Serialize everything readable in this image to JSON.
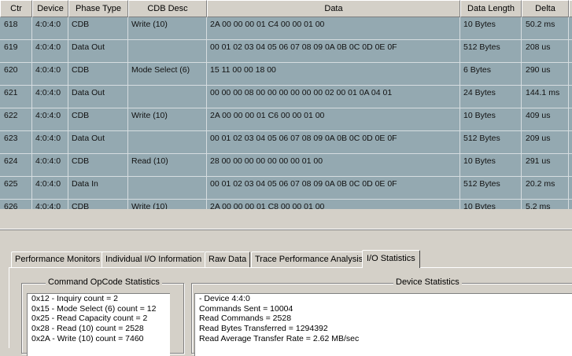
{
  "columns": [
    "Ctr",
    "Device",
    "Phase Type",
    "CDB Desc",
    "Data",
    "Data Length",
    "Delta"
  ],
  "rows": [
    [
      "618",
      "4:0:4:0",
      "CDB",
      "Write (10)",
      "2A 00 00 00 01 C4 00 00 01 00",
      "10 Bytes",
      "50.2 ms"
    ],
    [
      "619",
      "4:0:4:0",
      "Data Out",
      "",
      "00 01 02 03 04 05 06 07 08 09 0A 0B 0C 0D 0E 0F",
      "512 Bytes",
      "208 us"
    ],
    [
      "620",
      "4:0:4:0",
      "CDB",
      "Mode Select (6)",
      "15 11 00 00 18 00",
      "6 Bytes",
      "290 us"
    ],
    [
      "621",
      "4:0:4:0",
      "Data Out",
      "",
      "00 00 00 08 00 00 00 00 00 00 02 00 01 0A 04 01",
      "24 Bytes",
      "144.1 ms"
    ],
    [
      "622",
      "4:0:4:0",
      "CDB",
      "Write (10)",
      "2A 00 00 00 01 C6 00 00 01 00",
      "10 Bytes",
      "409 us"
    ],
    [
      "623",
      "4:0:4:0",
      "Data Out",
      "",
      "00 01 02 03 04 05 06 07 08 09 0A 0B 0C 0D 0E 0F",
      "512 Bytes",
      "209 us"
    ],
    [
      "624",
      "4:0:4:0",
      "CDB",
      "Read (10)",
      "28 00 00 00 00 00 00 00 01 00",
      "10 Bytes",
      "291 us"
    ],
    [
      "625",
      "4:0:4:0",
      "Data In",
      "",
      "00 01 02 03 04 05 06 07 08 09 0A 0B 0C 0D 0E 0F",
      "512 Bytes",
      "20.2 ms"
    ],
    [
      "626",
      "4:0:4:0",
      "CDB",
      "Write (10)",
      "2A 00 00 00 01 C8 00 00 01 00",
      "10 Bytes",
      "5.2 ms"
    ]
  ],
  "tabs": [
    "Performance Monitors",
    "Individual I/O Information",
    "Raw Data",
    "Trace Performance Analysis",
    "I/O Statistics"
  ],
  "active_tab": "I/O Statistics",
  "opcode_group": {
    "title": "Command OpCode Statistics",
    "lines": [
      "0x12 - Inquiry count = 2",
      "0x15 - Mode Select (6) count = 12",
      "0x25 - Read Capacity count = 2",
      "0x28 - Read (10) count = 2528",
      "0x2A - Write (10) count = 7460"
    ]
  },
  "device_group": {
    "title": "Device Statistics",
    "lines": [
      "- Device 4:4:0",
      "Commands Sent = 10004",
      "Read Commands = 2528",
      "Read Bytes Transferred = 1294392",
      "Read Average Transfer Rate = 2.62 MB/sec"
    ]
  },
  "colors": {
    "row_background": "#94a9b1",
    "window_face": "#d4d0c8"
  }
}
